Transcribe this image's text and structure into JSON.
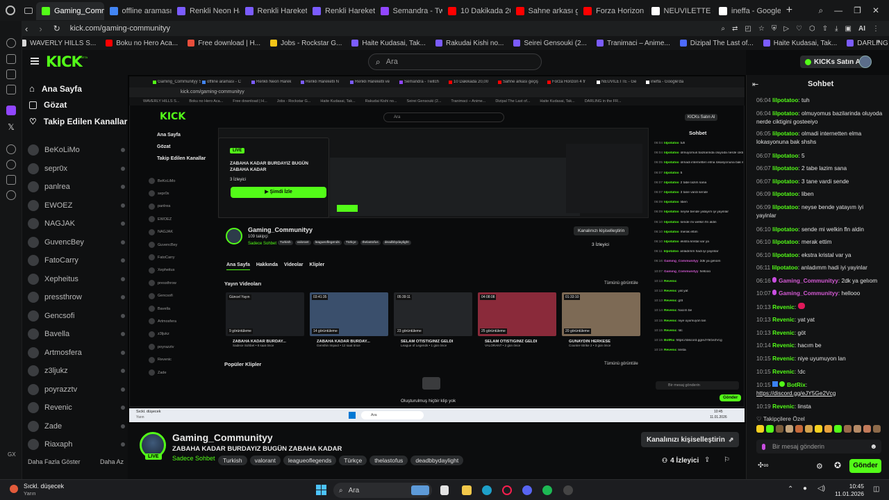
{
  "browser": {
    "tabs": [
      {
        "label": "Gaming_Communityy Stre",
        "color": "#53fc18",
        "active": true
      },
      {
        "label": "offline araması - C",
        "color": "#4285f4"
      },
      {
        "label": "Renkli Neon Harek",
        "color": "#7b5cff"
      },
      {
        "label": "Renkli Hareketli N",
        "color": "#7b5cff"
      },
      {
        "label": "Renkli Hareketli ve",
        "color": "#7b5cff"
      },
      {
        "label": "Semandra - Twitch",
        "color": "#9146ff"
      },
      {
        "label": "10 Dakikada 20,00",
        "color": "#ff0000"
      },
      {
        "label": "Sahne arkası geçiş",
        "color": "#ff0000"
      },
      {
        "label": "Forza Horizon 4 fr",
        "color": "#ff0000"
      },
      {
        "label": "NEUVILETTE - Ge",
        "color": "#ffffff"
      },
      {
        "label": "ineffa - Google'da",
        "color": "#ffffff"
      }
    ],
    "url": "kick.com/gaming-communityy",
    "ai_label": "AI",
    "bookmarks": [
      {
        "label": "WAVERLY HILLS S...",
        "color": "#d9d9d9"
      },
      {
        "label": "Boku no Hero Aca...",
        "color": "#ff0000"
      },
      {
        "label": "Free download | H...",
        "color": "#e84e3c"
      },
      {
        "label": "Jobs - Rockstar G...",
        "color": "#f5c518"
      },
      {
        "label": "Haite Kudasai, Tak...",
        "color": "#7b5cff"
      },
      {
        "label": "Rakudai Kishi no...",
        "color": "#7b5cff"
      },
      {
        "label": "Seirei Gensouki (2...",
        "color": "#7b5cff"
      },
      {
        "label": "Tranimaci – Anime...",
        "color": "#7b5cff"
      },
      {
        "label": "Dizipal The Last of...",
        "color": "#4d6bff"
      },
      {
        "label": "Haite Kudasai, Tak...",
        "color": "#7b5cff"
      },
      {
        "label": "DARLING in the FR...",
        "color": "#7b5cff"
      }
    ]
  },
  "kick": {
    "logo": "KICK",
    "logo_beta": "BETA",
    "search_placeholder": "Ara",
    "buy_kicks": "KICKs Satın Al",
    "nav": [
      {
        "label": "Ana Sayfa",
        "icon": "home-icon"
      },
      {
        "label": "Gözat",
        "icon": "browse-icon"
      },
      {
        "label": "Takip Edilen Kanallar",
        "icon": "heart-icon"
      }
    ],
    "channels": [
      "BeKoLiMo",
      "sepr0x",
      "panlrea",
      "EWOEZ",
      "NAGJAK",
      "GuvencBey",
      "FatoCarry",
      "Xepheitus",
      "pressthrow",
      "Gencsofi",
      "Bavella",
      "Artmosfera",
      "z3ljukz",
      "poyrazztv",
      "Revenic",
      "Zade",
      "Riaxaph"
    ],
    "show_more": "Daha Fazla Göster",
    "show_less": "Daha Az"
  },
  "chat": {
    "title": "Sohbet",
    "messages": [
      {
        "time": "06:04",
        "user": "lilpotatoo",
        "text": "tuh"
      },
      {
        "time": "06:04",
        "user": "lilpotatoo",
        "text": "olmuyomus bazilarinda oluyoda nerde ciktigini gosteeiyo"
      },
      {
        "time": "06:05",
        "user": "lilpotatoo",
        "text": "olmadi internetten elma lokasyonuna bak shshs"
      },
      {
        "time": "06:07",
        "user": "lilpotatoo",
        "text": "5"
      },
      {
        "time": "06:07",
        "user": "lilpotatoo",
        "text": "2 tabe lazim sana"
      },
      {
        "time": "06:07",
        "user": "lilpotatoo",
        "text": "3 tane vardi sende"
      },
      {
        "time": "06:09",
        "user": "lilpotatoo",
        "text": "liben"
      },
      {
        "time": "06:09",
        "user": "lilpotatoo",
        "text": "neyse bende yatayım iyi yayinlar"
      },
      {
        "time": "06:10",
        "user": "lilpotatoo",
        "text": "sende mi welkin fln aldin"
      },
      {
        "time": "06:10",
        "user": "lilpotatoo",
        "text": "merak ettim"
      },
      {
        "time": "06:10",
        "user": "lilpotatoo",
        "text": "ekstra kristal var ya"
      },
      {
        "time": "06:11",
        "user": "lilpotatoo",
        "text": "anladımm hadi iyi yayinlar"
      },
      {
        "time": "06:16",
        "user": "Gaming_Communityy",
        "text": "2dk ya gelıom",
        "style": "pink"
      },
      {
        "time": "10:07",
        "user": "Gaming_Communityy",
        "text": "hellooo",
        "style": "pink"
      },
      {
        "time": "10:13",
        "user": "Revenic",
        "text": ""
      },
      {
        "time": "10:13",
        "user": "Revenic",
        "text": "yat yat"
      },
      {
        "time": "10:13",
        "user": "Revenic",
        "text": "göt"
      },
      {
        "time": "10:14",
        "user": "Revenic",
        "text": "hacım be"
      },
      {
        "time": "10:15",
        "user": "Revenic",
        "text": "niye uyumuyon lan"
      },
      {
        "time": "10:15",
        "user": "Revenic",
        "text": "!dc"
      },
      {
        "time": "10:15",
        "user": "BotRix",
        "text": "https://discord.gg/eJY5Ge2Vcg",
        "style": "bot"
      },
      {
        "time": "10:19",
        "user": "Revenic",
        "text": "linsta"
      }
    ],
    "followers_label": "Takipçilere Özel",
    "input_placeholder": "Bir mesaj gönderin",
    "send": "Gönder"
  },
  "stream_overlay": {
    "live": "LIVE",
    "title": "ZABAHA KADAR BURDAYIZ BUGÜN ZABAHA KADAR",
    "viewers": "3 İzleyici",
    "watch_now": "Şimdi İzle"
  },
  "inner": {
    "channel": "Gaming_Communityy",
    "followers": "109 takipçi",
    "customize": "Kanalınızı kişiselleştirin",
    "viewers": "3 İzleyici",
    "tabs": [
      "Ana Sayfa",
      "Hakkında",
      "Videolar",
      "Klipler"
    ],
    "section_videos": "Yayın Videoları",
    "show_all": "Tümünü görüntüle",
    "section_clips": "Popüler Klipler",
    "no_clips": "Oluşturulmuş hiçbir klip yok",
    "videos": [
      {
        "badge": "Güncel Yayın",
        "views": "9 görüntüleme",
        "title": "ZABAHA KADAR BURDAY...",
        "sub": "Sadece Sohbet • 8 saat önce"
      },
      {
        "badge": "03:41:35",
        "views": "14 görüntüleme",
        "title": "ZABAHA KADAR BURDAY...",
        "sub": "Genshin Impact • 12 saat önce"
      },
      {
        "badge": "05:39:11",
        "views": "23 görüntüleme",
        "title": "SELAM OTİSTİĞİNİZ GELDİ",
        "sub": "League of Legends • 1 gün önce"
      },
      {
        "badge": "04:08:08",
        "views": "25 görüntüleme",
        "title": "SELAM OTİSTİĞİNİZ GELDİ",
        "sub": "VALORANT • 2 gün önce"
      },
      {
        "badge": "01:33:10",
        "views": "20 görüntüleme",
        "title": "GÜNAYDIN HERKESE",
        "sub": "Counter-Strike 2 • 3 gün önce"
      }
    ]
  },
  "channel_info": {
    "name": "Gaming_Communityy",
    "title": "ZABAHA KADAR BURDAYIZ BUGÜN ZABAHA KADAR",
    "category": "Sadece Sohbet",
    "tags": [
      "Turkish",
      "valorant",
      "leagueoflegends",
      "Türkçe",
      "thelastofus",
      "deadbbydaylight"
    ],
    "live": "LIVE",
    "customize": "Kanalınızı kişiselleştirin",
    "viewers": "4 İzleyici"
  },
  "taskbar": {
    "weather_title": "Sıckl. düşecek",
    "weather_sub": "Yarın",
    "search": "Ara",
    "time": "10:45",
    "date": "11.01.2026"
  }
}
